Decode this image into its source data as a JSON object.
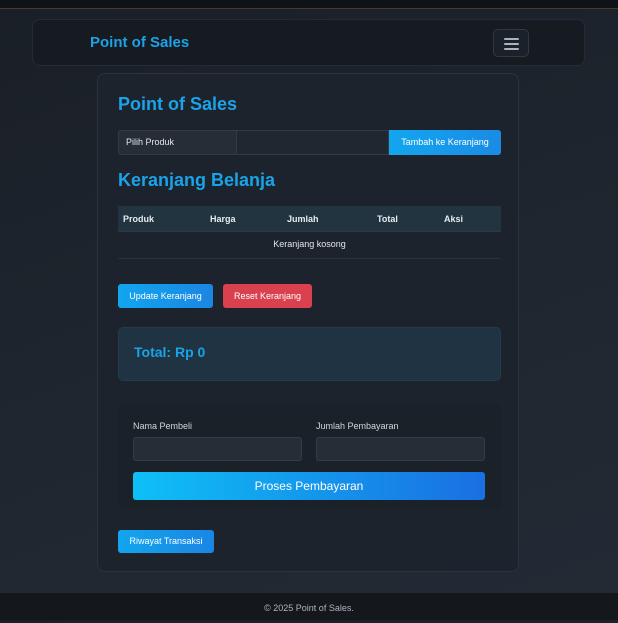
{
  "navbar": {
    "brand": "Point of Sales",
    "menu_icon": "hamburger-icon"
  },
  "card": {
    "title": "Point of Sales",
    "product_select": {
      "label": "Pilih Produk",
      "value": ""
    },
    "add_button": "Tambah ke Keranjang",
    "cart_title": "Keranjang Belanja",
    "table": {
      "headers": [
        "Produk",
        "Harga",
        "Jumlah",
        "Total",
        "Aksi"
      ],
      "empty_message": "Keranjang kosong"
    },
    "update_button": "Update Keranjang",
    "reset_button": "Reset Keranjang",
    "total_text": "Total: Rp 0",
    "payment": {
      "buyer_label": "Nama Pembeli",
      "buyer_value": "",
      "amount_label": "Jumlah Pembayaran",
      "amount_value": "",
      "process_button": "Proses Pembayaran"
    },
    "history_button": "Riwayat Transaksi"
  },
  "footer": {
    "text": "© 2025 Point of Sales."
  },
  "colors": {
    "accent": "#1aa3e8",
    "danger": "#d9414e",
    "button_blue": "#1a86e4"
  }
}
